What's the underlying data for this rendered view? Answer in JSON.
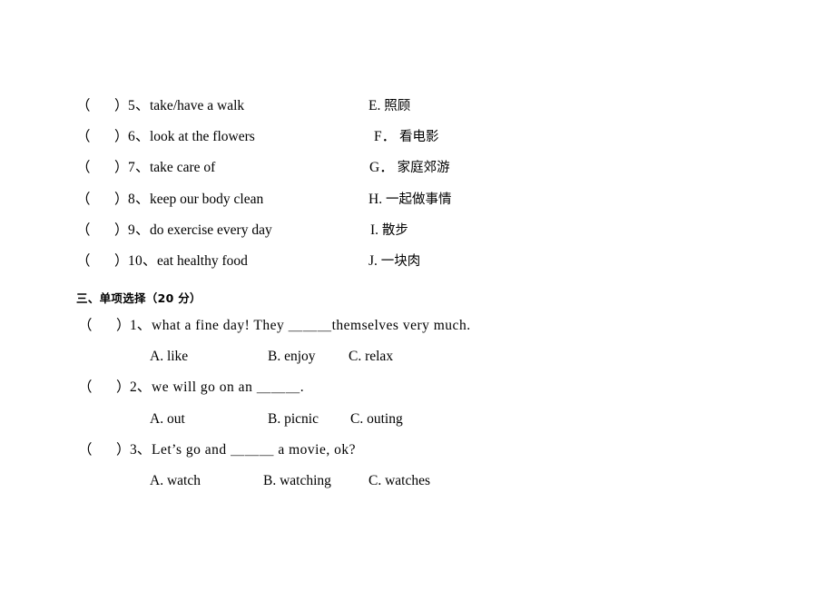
{
  "document": {
    "page_background": "#ffffff",
    "text_color": "#000000"
  },
  "matching_section": {
    "rows": [
      {
        "paren_open": "（",
        "paren_close": "）",
        "number": "5、",
        "english": "take/have a walk",
        "letter": "E.",
        "chinese": "照顾"
      },
      {
        "paren_open": "（",
        "paren_close": "）",
        "number": "6、",
        "english": "look at the flowers",
        "letter": "F．",
        "chinese": "看电影"
      },
      {
        "paren_open": "（",
        "paren_close": "）",
        "number": "7、",
        "english": "take care of",
        "letter": "G．",
        "chinese": "家庭郊游"
      },
      {
        "paren_open": "（",
        "paren_close": "）",
        "number": "8、",
        "english": "keep our body clean",
        "letter": "H.",
        "chinese": "一起做事情"
      },
      {
        "paren_open": "（",
        "paren_close": "）",
        "number": "9、",
        "english": "do exercise every day",
        "letter": "I.",
        "chinese": "散步"
      },
      {
        "paren_open": "（",
        "paren_close": "）",
        "number": "10、",
        "english": "eat healthy food",
        "letter": "J.",
        "chinese": "一块肉"
      }
    ]
  },
  "multiple_choice_section": {
    "heading": "三、单项选择（20 分）",
    "questions": [
      {
        "paren_open": "（",
        "paren_close": "）",
        "number": "1、",
        "text": "what a fine day! They ＿＿＿themselves very much.",
        "options": {
          "a": "A. like",
          "b": "B. enjoy",
          "c": "C. relax"
        }
      },
      {
        "paren_open": "（",
        "paren_close": "）",
        "number": "2、",
        "text": "we will go on an ＿＿＿.",
        "options": {
          "a": "A. out",
          "b": "B. picnic",
          "c": "C. outing"
        }
      },
      {
        "paren_open": "（",
        "paren_close": "）",
        "number": "3、",
        "text": "Let’s go and ＿＿＿ a movie, ok?",
        "options": {
          "a": "A. watch",
          "b": "B. watching",
          "c": "C. watches"
        }
      }
    ]
  }
}
